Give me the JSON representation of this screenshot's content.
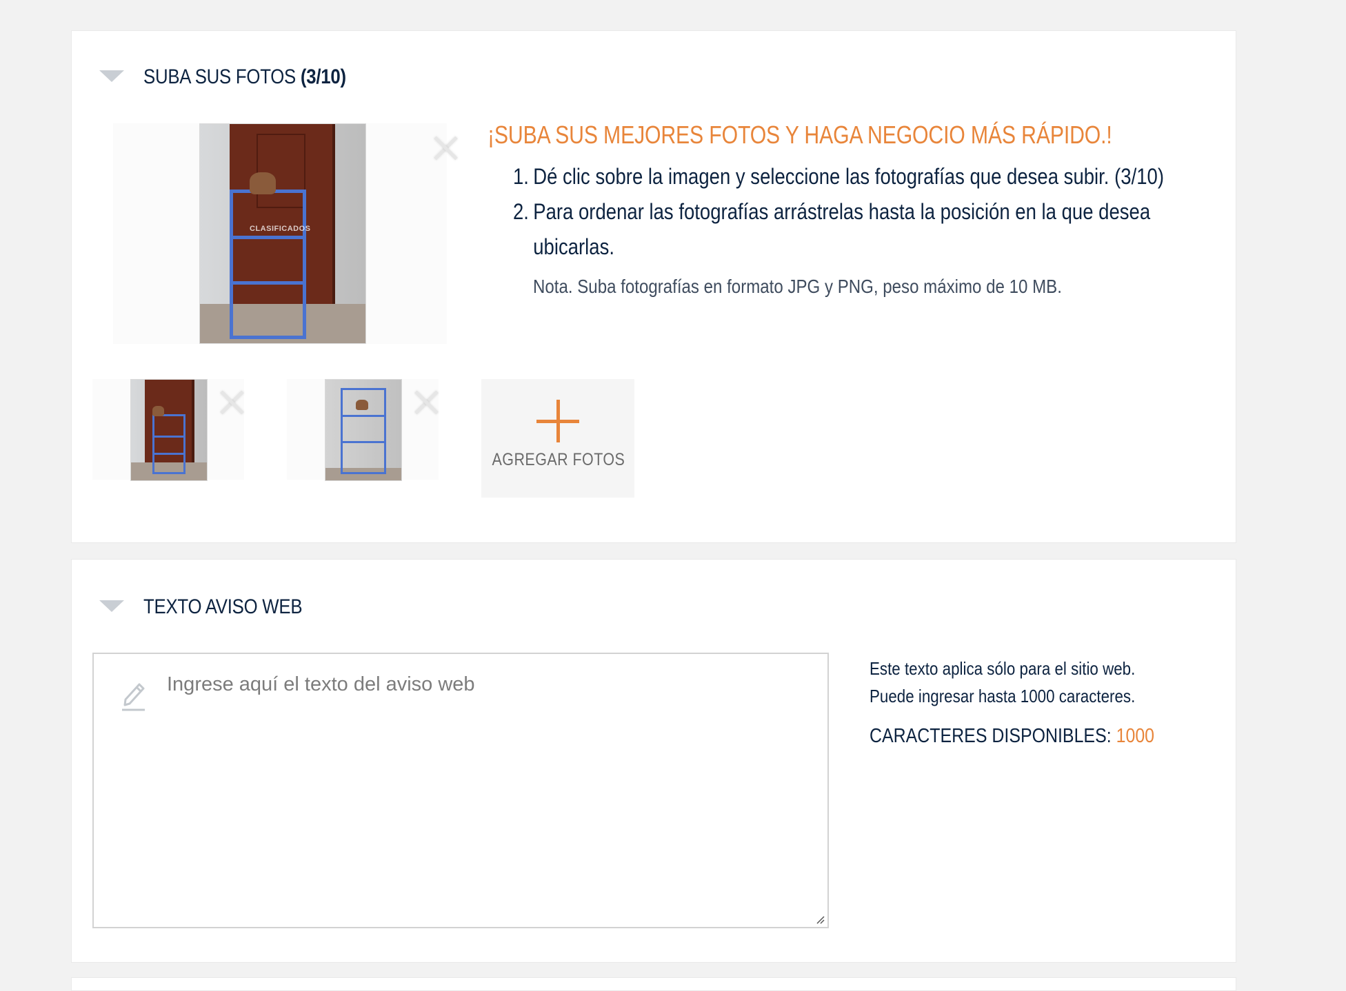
{
  "colors": {
    "accent": "#e8853a",
    "text": "#0d2340",
    "page_background": "#f2f2f2"
  },
  "photos_section": {
    "title": "SUBA SUS FOTOS",
    "count": "(3/10)",
    "main_photo": {
      "watermark": "CLASIFICADOS",
      "icon": "photo-main"
    },
    "thumbnails": [
      {
        "icon": "photo-thumb-1"
      },
      {
        "icon": "photo-thumb-2"
      }
    ],
    "add_button_label": "AGREGAR FOTOS",
    "tips": {
      "title": "¡SUBA SUS MEJORES FOTOS Y HAGA NEGOCIO MÁS RÁPIDO.!",
      "items": [
        {
          "number": "1.",
          "text": "Dé clic sobre la imagen y seleccione las fotografías que desea subir. (3/10)"
        },
        {
          "number": "2.",
          "text": "Para ordenar las fotografías arrástrelas hasta la posición en la que desea ubicarlas."
        }
      ],
      "note": "Nota. Suba fotografías en formato JPG y PNG, peso máximo de 10 MB."
    }
  },
  "text_section": {
    "title": "TEXTO AVISO WEB",
    "textarea": {
      "value": "",
      "placeholder": "Ingrese aquí el texto del aviso web"
    },
    "info_line_1": "Este texto aplica sólo para el sitio web.",
    "info_line_2": "Puede ingresar hasta 1000 caracteres.",
    "counter_label": "CARACTERES DISPONIBLES:",
    "counter_value": "1000"
  }
}
